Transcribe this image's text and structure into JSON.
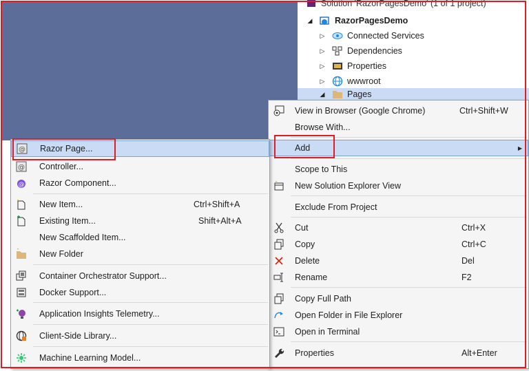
{
  "solution_explorer": {
    "solution_row": "Solution 'RazorPagesDemo' (1 of 1 project)",
    "project": "RazorPagesDemo",
    "items": [
      {
        "label": "Connected Services",
        "icon": "connected-services-icon"
      },
      {
        "label": "Dependencies",
        "icon": "dependencies-icon"
      },
      {
        "label": "Properties",
        "icon": "wrench-icon"
      },
      {
        "label": "wwwroot",
        "icon": "globe-icon"
      },
      {
        "label": "Pages",
        "icon": "folder-icon"
      }
    ]
  },
  "context_menu": {
    "items": [
      {
        "label": "View in Browser (Google Chrome)",
        "shortcut": "Ctrl+Shift+W",
        "icon": "view-in-browser-icon"
      },
      {
        "label": "Browse With...",
        "shortcut": "",
        "icon": ""
      },
      {
        "label": "Add",
        "shortcut": "",
        "icon": "",
        "has_submenu": true
      },
      {
        "label": "Scope to This",
        "shortcut": "",
        "icon": ""
      },
      {
        "label": "New Solution Explorer View",
        "shortcut": "",
        "icon": "new-view-icon"
      },
      {
        "label": "Exclude From Project",
        "shortcut": "",
        "icon": ""
      },
      {
        "label": "Cut",
        "shortcut": "Ctrl+X",
        "icon": "scissors-icon"
      },
      {
        "label": "Copy",
        "shortcut": "Ctrl+C",
        "icon": "copy-icon"
      },
      {
        "label": "Delete",
        "shortcut": "Del",
        "icon": "delete-icon"
      },
      {
        "label": "Rename",
        "shortcut": "F2",
        "icon": "rename-icon"
      },
      {
        "label": "Copy Full Path",
        "shortcut": "",
        "icon": "copy-path-icon"
      },
      {
        "label": "Open Folder in File Explorer",
        "shortcut": "",
        "icon": "open-folder-icon"
      },
      {
        "label": "Open in Terminal",
        "shortcut": "",
        "icon": "terminal-icon"
      },
      {
        "label": "Properties",
        "shortcut": "Alt+Enter",
        "icon": "wrench-icon"
      }
    ]
  },
  "add_submenu": {
    "items": [
      {
        "label": "Razor Page...",
        "shortcut": "",
        "icon": "razor-page-icon"
      },
      {
        "label": "Controller...",
        "shortcut": "",
        "icon": "controller-icon"
      },
      {
        "label": "Razor Component...",
        "shortcut": "",
        "icon": "razor-component-icon"
      },
      {
        "label": "New Item...",
        "shortcut": "Ctrl+Shift+A",
        "icon": "new-item-icon"
      },
      {
        "label": "Existing Item...",
        "shortcut": "Shift+Alt+A",
        "icon": "existing-item-icon"
      },
      {
        "label": "New Scaffolded Item...",
        "shortcut": "",
        "icon": ""
      },
      {
        "label": "New Folder",
        "shortcut": "",
        "icon": "new-folder-icon"
      },
      {
        "label": "Container Orchestrator Support...",
        "shortcut": "",
        "icon": "container-icon"
      },
      {
        "label": "Docker Support...",
        "shortcut": "",
        "icon": "docker-icon"
      },
      {
        "label": "Application Insights Telemetry...",
        "shortcut": "",
        "icon": "insights-icon"
      },
      {
        "label": "Client-Side Library...",
        "shortcut": "",
        "icon": "library-icon"
      },
      {
        "label": "Machine Learning Model...",
        "shortcut": "",
        "icon": "ml-model-icon"
      }
    ]
  },
  "colors": {
    "editor_background": "#5c6d99",
    "highlight": "#c9dbf5",
    "annotation_red": "#e01b24"
  }
}
